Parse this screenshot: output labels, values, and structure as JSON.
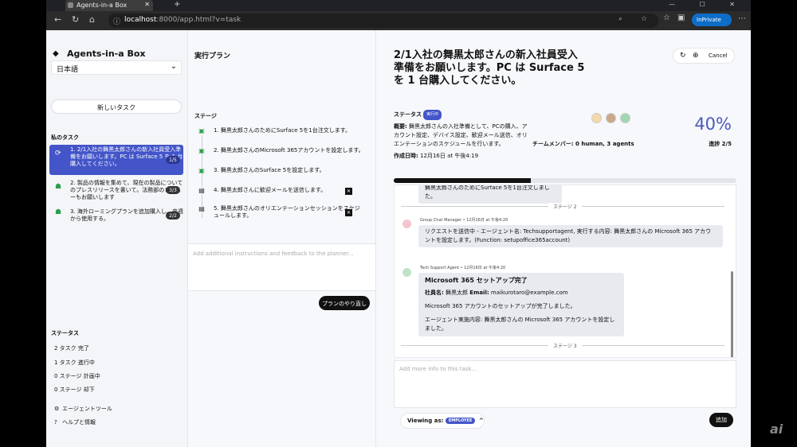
{
  "browser": {
    "tab_title": "Agents-in-a Box",
    "url_host": "localhost",
    "url_rest": ":8000/app.html?v=task",
    "inprivate_label": "InPrivate"
  },
  "sidebar": {
    "brand": "Agents-in-a Box",
    "language": "日本語",
    "new_task_label": "新しいタスク",
    "my_tasks_heading": "私のタスク",
    "tasks": [
      {
        "label": "1. 2/1入社の舞黒太郎さんの新入社員受入準備をお願いします。PC は Surface 5 を 1 台購入してください。",
        "badge": "1/5"
      },
      {
        "label": "2. 製品の情報を集めて、現在の製品についてのプレスリリースを書いて。法務部のレビューもお願いします",
        "badge": "3/3"
      },
      {
        "label": "3. 海外ローミングプランを追加購入し、来週から使用する。",
        "badge": "2/2"
      }
    ],
    "status_heading": "ステータス",
    "stats": [
      "2 タスク 完了",
      "1 タスク 進行中",
      "0 ステージ 計画中",
      "0 ステージ 却下"
    ],
    "footer": [
      {
        "label": "エージェントツール",
        "icon": "gear-icon"
      },
      {
        "label": "ヘルプと情報",
        "icon": "help-icon"
      }
    ]
  },
  "plan": {
    "title": "実行プラン",
    "stage_heading": "ステージ",
    "steps": [
      {
        "text": "1. 舞黒太郎さんのためにSurface 5を1台注文します。",
        "icon": "check-icon",
        "status": "done"
      },
      {
        "text": "2. 舞黒太郎さんのMicrosoft 365アカウントを設定します。",
        "icon": "check-icon",
        "status": "done"
      },
      {
        "text": "3. 舞黒太郎さんのSurface 5を設定します。",
        "icon": "check-icon",
        "status": "done"
      },
      {
        "text": "4. 舞黒太郎さんに歓迎メールを送信します。",
        "icon": "calendar-icon",
        "status": "pending"
      },
      {
        "text": "5. 舞黒太郎さんのオリエンテーションセッションをスケジュールします。",
        "icon": "calendar-icon",
        "status": "pending"
      }
    ],
    "feedback_placeholder": "Add additional instructions and feedback to the planner...",
    "replan_label": "プランのやり直し"
  },
  "task": {
    "title": "2/1入社の舞黒太郎さんの新入社員受入準備をお願いします。PC は Surface 5 を 1 台購入してください。",
    "cancel_label": "Cancel",
    "status_label": "ステータス",
    "status_value": "実行中",
    "summary_label": "概要:",
    "summary_text": "舞黒太郎さんの入社準備として、PCの購入、アカウント設定、デバイス設定、歓迎メール送信、オリエンテーションのスケジュールを行います。",
    "created_label": "作成日時:",
    "created_value": "12月16日 at 午後4:19",
    "team_label": "チームメンバー: 0 human, 3 agents",
    "progress_pct": "40%",
    "progress_fraction": 0.4,
    "progress_label": "進捗 2/5"
  },
  "chat": {
    "top_partial": "舞黒太郎さんのためにSurface 5を1台注文しました。",
    "stage2_label": "ステージ 2",
    "msg1_sender": "Group Chat Manager • 12月16日 at 午後4:20",
    "msg1_text": "リクエストを送信中 - エージェント名: Techsupportagent, 実行する内容: 舞黒太郎さんの Microsoft 365 アカウントを設定します。(Function: setupoffice365account)",
    "msg2_sender": "Tech Support Agent • 12月16日 at 午後4:20",
    "msg2_title": "Microsoft 365 セットアップ完了",
    "msg2_line1_label": "社員名:",
    "msg2_line1_value": "舞黒太郎",
    "msg2_line1_email_label": "Email:",
    "msg2_line1_email": "maikurotaro@example.com",
    "msg2_line2": "Microsoft 365 アカウントのセットアップが完了しました。",
    "msg2_line3": "エージェント実施内容: 舞黒太郎さんの Microsoft 365 アカウントを設定しました。",
    "stage3_label": "ステージ 3",
    "composer_placeholder": "Add more info to this task...",
    "viewing_label": "Viewing as:",
    "viewing_role": "EMPLOYEE",
    "add_label": "追加"
  },
  "watermark": "ai"
}
